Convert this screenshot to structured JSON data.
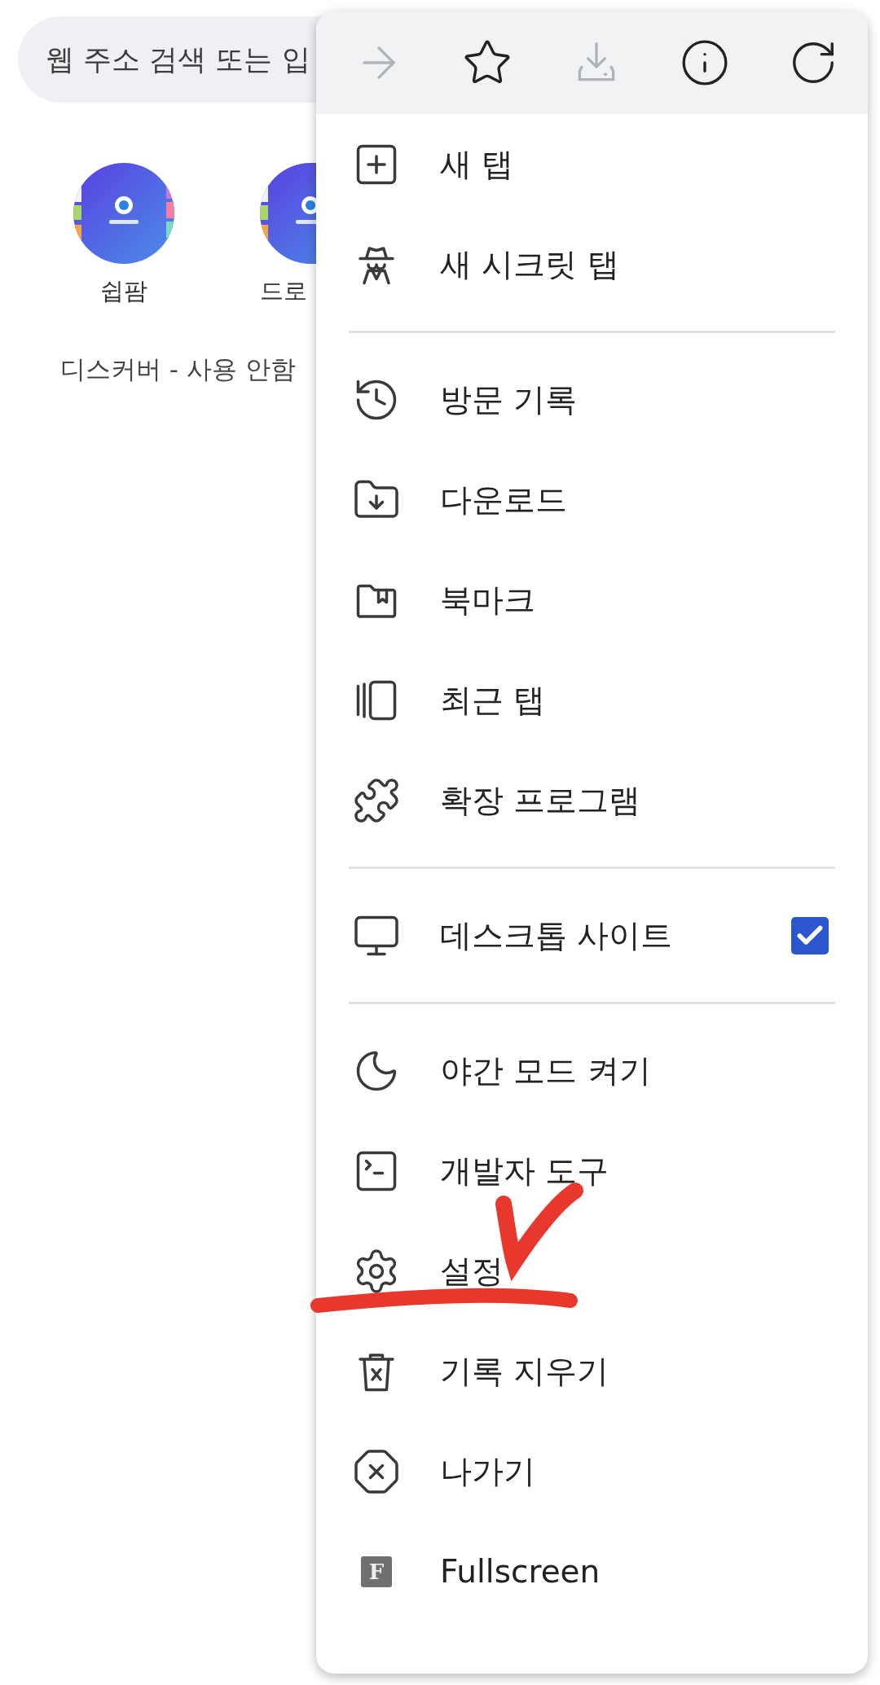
{
  "search": {
    "placeholder": "웹 주소 검색 또는 입"
  },
  "shortcuts": [
    {
      "label": "쉽팜",
      "kind": "picture"
    },
    {
      "label": "드로",
      "kind": "picture"
    }
  ],
  "discover": "디스커버 - 사용 안함",
  "toolbar": [
    {
      "disabled": true
    },
    {
      "disabled": false
    },
    {
      "disabled": true
    },
    {
      "disabled": false
    },
    {
      "disabled": false
    }
  ],
  "menu": [
    {
      "kind": "item",
      "label": "새 탭"
    },
    {
      "kind": "item",
      "label": "새 시크릿 탭"
    },
    {
      "kind": "divider"
    },
    {
      "kind": "item",
      "label": "방문 기록"
    },
    {
      "kind": "item",
      "label": "다운로드"
    },
    {
      "kind": "item",
      "label": "북마크"
    },
    {
      "kind": "item",
      "label": "최근 탭"
    },
    {
      "kind": "item",
      "label": "확장 프로그램"
    },
    {
      "kind": "divider"
    },
    {
      "kind": "toggle",
      "label": "데스크톱 사이트",
      "checked": true
    },
    {
      "kind": "divider"
    },
    {
      "kind": "item",
      "label": "야간 모드 켜기"
    },
    {
      "kind": "item",
      "label": "개발자 도구"
    },
    {
      "kind": "item",
      "label": "설정",
      "annotated": true
    },
    {
      "kind": "item",
      "label": "기록 지우기"
    },
    {
      "kind": "item",
      "label": "나가기"
    },
    {
      "kind": "extension",
      "icon_text": "F",
      "label": "Fullscreen"
    }
  ]
}
